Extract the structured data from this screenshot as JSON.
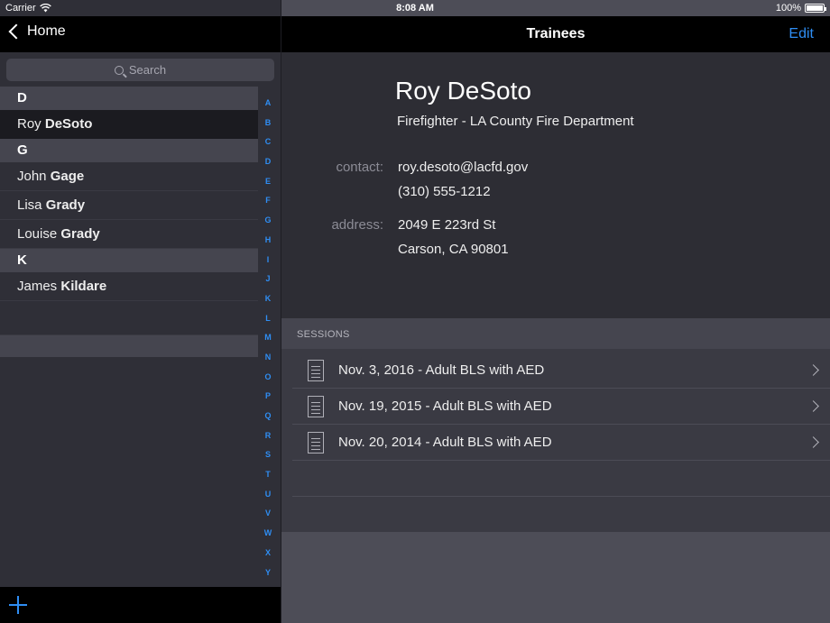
{
  "status_bar": {
    "carrier": "Carrier",
    "time": "8:08 AM",
    "battery": "100%"
  },
  "sidebar": {
    "back_label": "Home",
    "search_placeholder": "Search",
    "sections": [
      {
        "letter": "D",
        "rows": [
          {
            "first": "Roy",
            "last": "DeSoto",
            "selected": true
          }
        ]
      },
      {
        "letter": "G",
        "rows": [
          {
            "first": "John",
            "last": "Gage"
          },
          {
            "first": "Lisa",
            "last": "Grady"
          },
          {
            "first": "Louise",
            "last": "Grady"
          }
        ]
      },
      {
        "letter": "K",
        "rows": [
          {
            "first": "James",
            "last": "Kildare"
          }
        ]
      }
    ],
    "index_letters": [
      "A",
      "B",
      "C",
      "D",
      "E",
      "F",
      "G",
      "H",
      "I",
      "J",
      "K",
      "L",
      "M",
      "N",
      "O",
      "P",
      "Q",
      "R",
      "S",
      "T",
      "U",
      "V",
      "W",
      "X",
      "Y"
    ],
    "add_icon": "plus-icon"
  },
  "detail": {
    "nav_title": "Trainees",
    "edit_label": "Edit",
    "name": "Roy DeSoto",
    "subtitle": "Firefighter - LA County Fire Department",
    "contact_label": "contact:",
    "email": "roy.desoto@lacfd.gov",
    "phone": "(310) 555-1212",
    "address_label": "address:",
    "address_line1": "2049 E 223rd St",
    "address_line2": "Carson, CA 90801",
    "sessions_header": "SESSIONS",
    "sessions": [
      "Nov. 3, 2016 - Adult BLS with AED",
      "Nov. 19, 2015 - Adult BLS with AED",
      "Nov. 20, 2014 - Adult BLS with AED"
    ]
  },
  "colors": {
    "accent": "#2f8ef4",
    "sidebar_bg": "#2f2f37",
    "header_bg": "#45454f",
    "profile_bg": "#2d2d34"
  }
}
